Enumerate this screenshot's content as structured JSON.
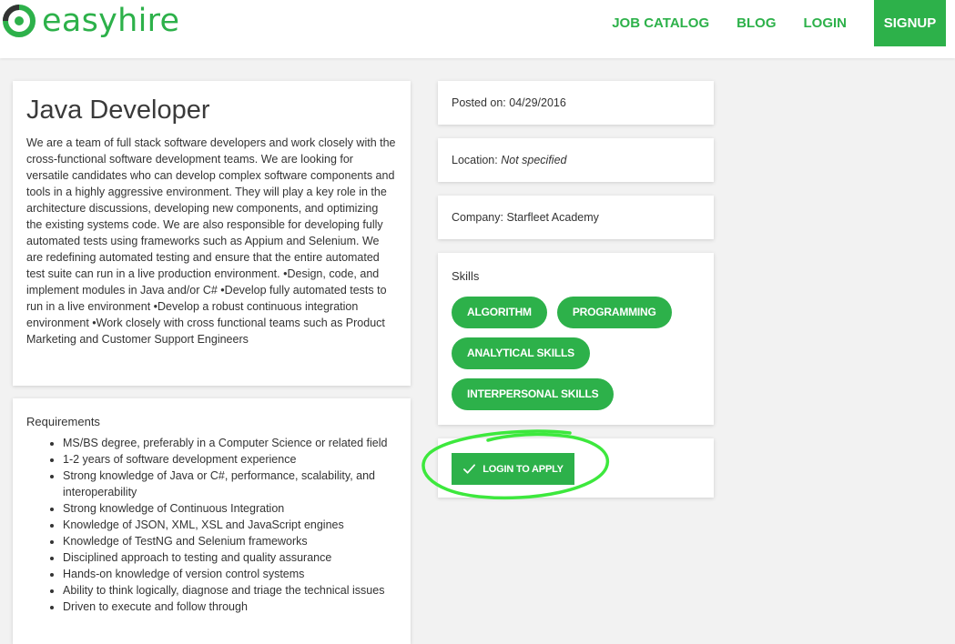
{
  "brand": {
    "name": "easyhire",
    "color": "#2db14a"
  },
  "nav": {
    "job_catalog": "JOB CATALOG",
    "blog": "BLOG",
    "login": "LOGIN",
    "signup": "SIGNUP"
  },
  "job": {
    "title": "Java Developer",
    "description": "We are a team of full stack software developers and work closely with the cross-functional software development teams. We are looking for versatile candidates who can develop complex software components and tools in a highly aggressive environment. They will play a key role in the architecture discussions, developing new components, and optimizing the existing systems code. We are also responsible for developing fully automated tests using frameworks such as Appium and Selenium. We are redefining automated testing and ensure that the entire automated test suite can run in a live production environment. •Design, code, and implement modules in Java and/or C# •Develop fully automated tests to run in a live environment •Develop a robust continuous integration environment •Work closely with cross functional teams such as Product Marketing and Customer Support Engineers"
  },
  "requirements": {
    "title": "Requirements",
    "items": [
      "MS/BS degree, preferably in a Computer Science or related field",
      "1-2 years of software development experience",
      "Strong knowledge of Java or C#, performance, scalability, and interoperability",
      "Strong knowledge of Continuous Integration",
      "Knowledge of JSON, XML, XSL and JavaScript engines",
      "Knowledge of TestNG and Selenium frameworks",
      "Disciplined approach to testing and quality assurance",
      "Hands-on knowledge of version control systems",
      "Ability to think logically, diagnose and triage the technical issues",
      "Driven to execute and follow through"
    ]
  },
  "posted": {
    "label": "Posted on:",
    "value": "04/29/2016"
  },
  "location": {
    "label": "Location:",
    "value": "Not specified"
  },
  "company": {
    "label": "Company:",
    "value": "Starfleet Academy"
  },
  "skills": {
    "title": "Skills",
    "tags": [
      "ALGORITHM",
      "PROGRAMMING",
      "ANALYTICAL SKILLS",
      "INTERPERSONAL SKILLS"
    ]
  },
  "apply": {
    "label": "LOGIN TO APPLY",
    "icon": "check-icon"
  }
}
